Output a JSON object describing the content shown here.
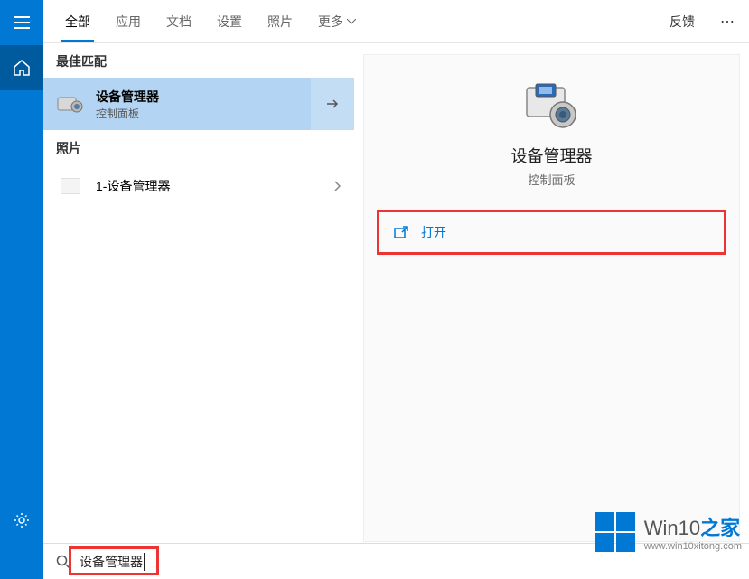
{
  "sidebar": {
    "menu": "hamburger-icon",
    "home": "home-icon",
    "settings": "gear-icon"
  },
  "tabs": {
    "items": [
      "全部",
      "应用",
      "文档",
      "设置",
      "照片",
      "更多"
    ],
    "feedback": "反馈"
  },
  "results": {
    "best_match_label": "最佳匹配",
    "best_match": {
      "title": "设备管理器",
      "subtitle": "控制面板"
    },
    "photos_label": "照片",
    "photo_item": "1-设备管理器"
  },
  "detail": {
    "title": "设备管理器",
    "subtitle": "控制面板",
    "open_label": "打开"
  },
  "search": {
    "query": "设备管理器"
  },
  "watermark": {
    "title_a": "Win10",
    "title_b": "之家",
    "url": "www.win10xitong.com"
  }
}
